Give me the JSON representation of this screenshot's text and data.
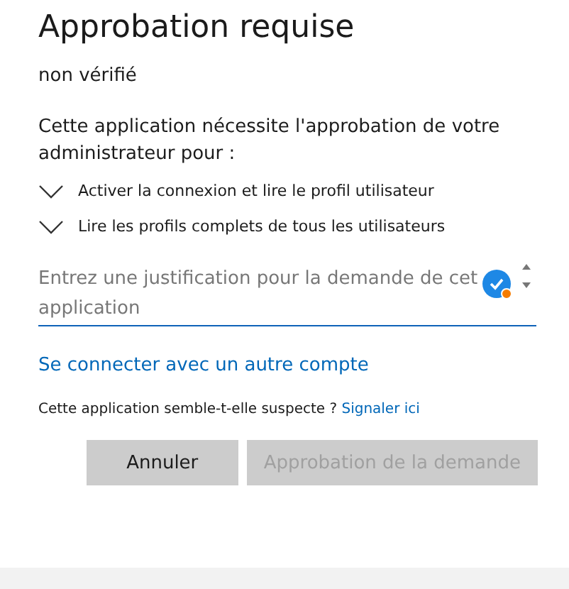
{
  "title": "Approbation requise",
  "subtitle": "non vérifié",
  "description": "Cette application nécessite l'approbation de votre administrateur pour :",
  "permissions": [
    {
      "label": "Activer la connexion et lire le profil utilisateur"
    },
    {
      "label": "Lire les profils complets de tous les utilisateurs"
    }
  ],
  "justification": {
    "placeholder": "Entrez une justification pour la demande de cet\napplication"
  },
  "switch_account_link": "Se connecter avec un autre compte",
  "suspect": {
    "text": "Cette application semble-t-elle suspecte ?",
    "link": "Signaler ici"
  },
  "buttons": [
    {
      "label": "Annuler",
      "disabled": false
    },
    {
      "label": "Approbation de la demande",
      "disabled": true
    }
  ]
}
